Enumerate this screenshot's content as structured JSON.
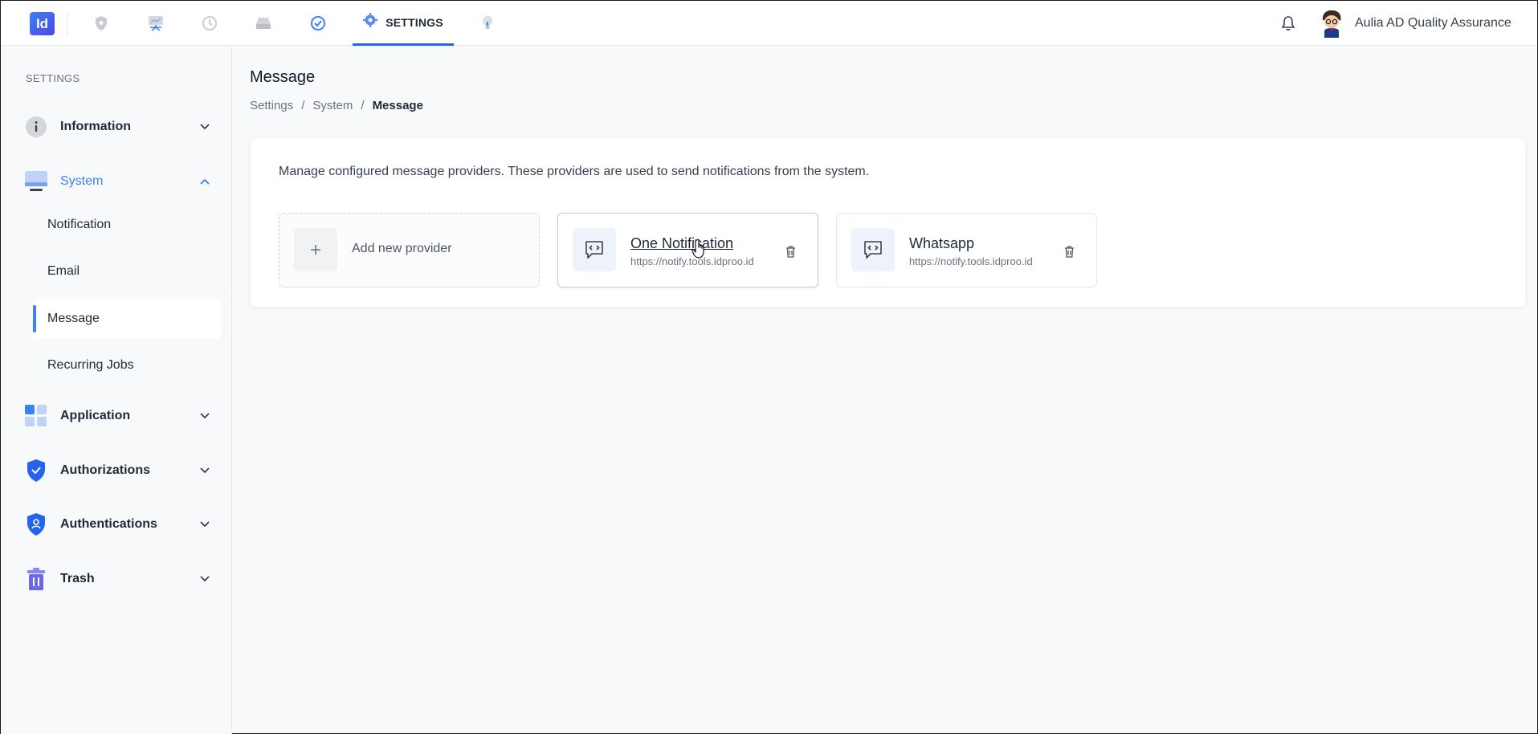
{
  "header": {
    "logo_text": "Id",
    "active_tab_label": "SETTINGS",
    "nav_icons": [
      "shield-icon",
      "presentation-icon",
      "history-icon",
      "drive-icon",
      "check-circle-icon",
      "gear-icon",
      "bulb-icon"
    ],
    "user_name": "Aulia AD Quality Assurance"
  },
  "sidebar": {
    "heading": "SETTINGS",
    "groups": [
      {
        "label": "Information",
        "icon": "info-icon",
        "expanded": false
      },
      {
        "label": "System",
        "icon": "monitor-icon",
        "expanded": true
      },
      {
        "label": "Application",
        "icon": "grid-icon",
        "expanded": false
      },
      {
        "label": "Authorizations",
        "icon": "shield-check-icon",
        "expanded": false
      },
      {
        "label": "Authentications",
        "icon": "shield-user-icon",
        "expanded": false
      },
      {
        "label": "Trash",
        "icon": "trash-icon",
        "expanded": false
      }
    ],
    "system_items": [
      {
        "label": "Notification",
        "active": false
      },
      {
        "label": "Email",
        "active": false
      },
      {
        "label": "Message",
        "active": true
      },
      {
        "label": "Recurring Jobs",
        "active": false
      }
    ]
  },
  "main": {
    "title": "Message",
    "breadcrumb": [
      "Settings",
      "System",
      "Message"
    ],
    "breadcrumb_sep": "/",
    "description": "Manage configured message providers. These providers are used to send notifications from the system.",
    "add_provider_label": "Add new provider",
    "providers": [
      {
        "name": "One Notification",
        "url": "https://notify.tools.idproo.id"
      },
      {
        "name": "Whatsapp",
        "url": "https://notify.tools.idproo.id"
      }
    ]
  },
  "colors": {
    "accent": "#3b82f6",
    "tab_underline": "#2563eb",
    "sidebar_bg": "#f8f9fb"
  }
}
